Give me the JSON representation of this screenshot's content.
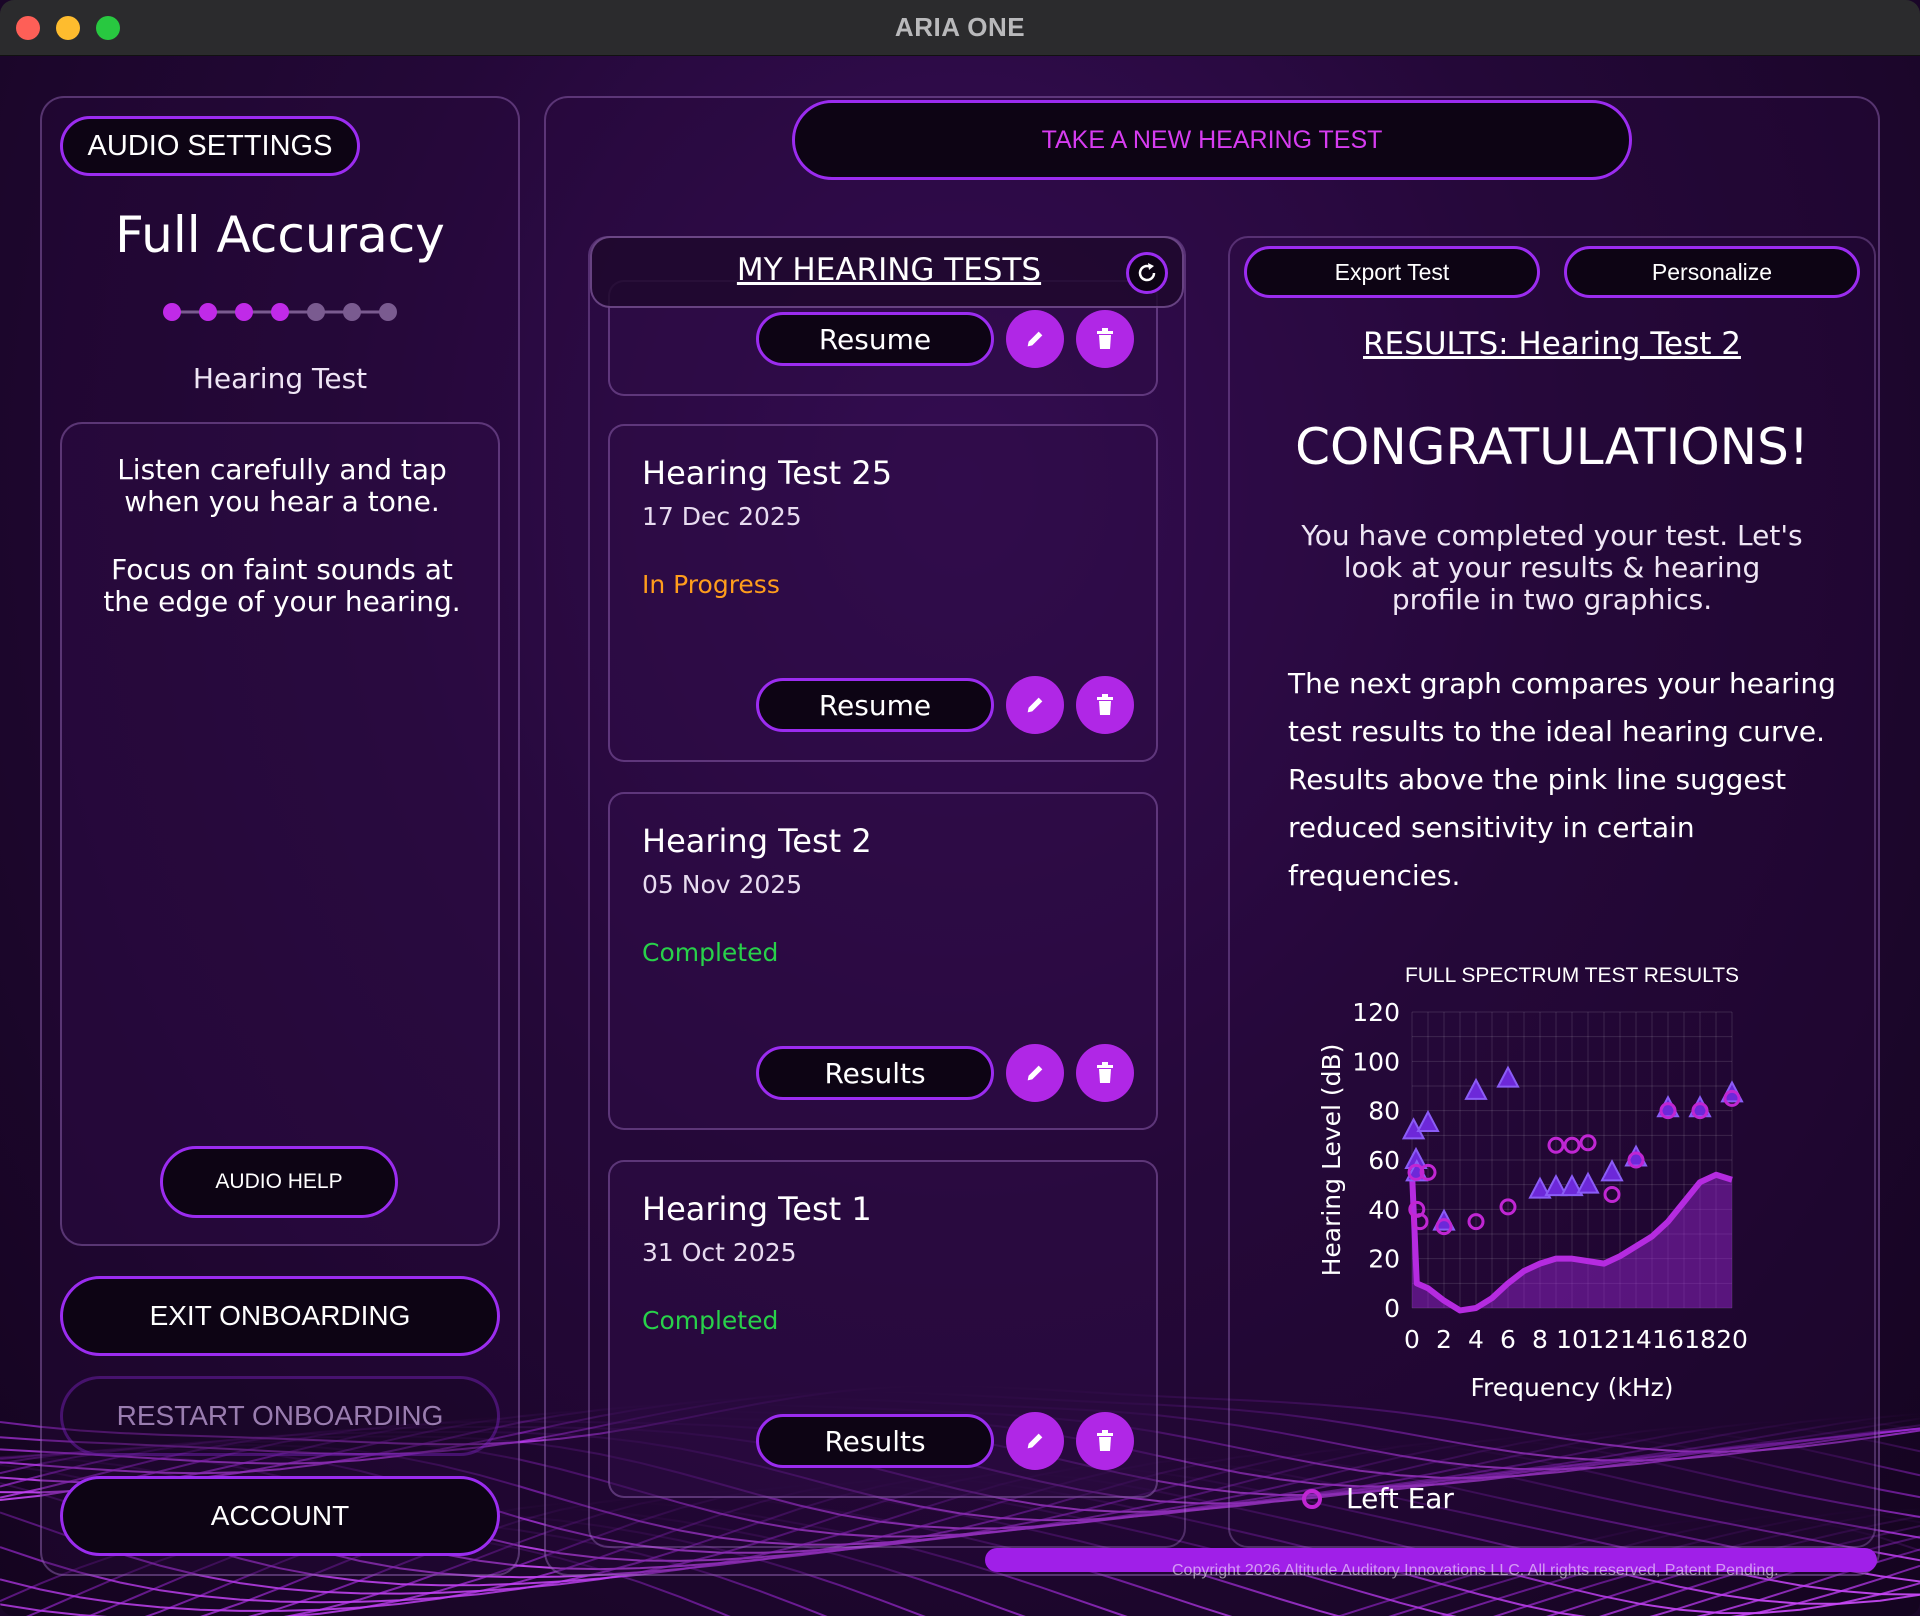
{
  "window": {
    "title": "ARIA ONE"
  },
  "left": {
    "audio_settings": "AUDIO SETTINGS",
    "mode": "Full Accuracy",
    "progress": {
      "total_steps": 7,
      "current_step": 4
    },
    "step_label": "Hearing Test",
    "instruction_1": "Listen carefully and tap when you hear a tone.",
    "instruction_2": "Focus on faint sounds at the edge of your hearing.",
    "audio_help": "AUDIO HELP",
    "exit_onboarding": "EXIT ONBOARDING",
    "restart_onboarding": "RESTART ONBOARDING",
    "account": "ACCOUNT"
  },
  "main": {
    "take_test": "TAKE A NEW HEARING TEST",
    "tests_header": "MY HEARING TESTS",
    "partial_card_button": "Resume",
    "tests": [
      {
        "title": "Hearing Test 25",
        "date": "17 Dec 2025",
        "status": "In Progress",
        "status_color": "#ff9d1c",
        "button": "Resume"
      },
      {
        "title": "Hearing Test 2",
        "date": "05 Nov 2025",
        "status": "Completed",
        "status_color": "#28d14a",
        "button": "Results"
      },
      {
        "title": "Hearing Test 1",
        "date": "31 Oct 2025",
        "status": "Completed",
        "status_color": "#28d14a",
        "button": "Results"
      }
    ]
  },
  "results": {
    "export": "Export Test",
    "personalize": "Personalize",
    "heading": "RESULTS: Hearing Test 2",
    "congrats": "CONGRATULATIONS!",
    "intro": "You have completed your test. Let's look at your results & hearing profile in two graphics.",
    "para_lines": [
      "The next graph compares your hearing",
      "test results to the ideal hearing curve.",
      "Results above the pink line suggest",
      "reduced sensitivity in certain",
      "frequencies."
    ],
    "legend_left": "Left Ear"
  },
  "chart_data": {
    "type": "scatter",
    "title": "FULL SPECTRUM TEST RESULTS",
    "xlabel": "Frequency (kHz)",
    "ylabel": "Hearing Level (dB)",
    "xlim": [
      0,
      20
    ],
    "ylim": [
      0,
      120
    ],
    "xticks": [
      0,
      2,
      4,
      6,
      8,
      10,
      12,
      14,
      16,
      18,
      20
    ],
    "yticks": [
      0,
      20,
      40,
      60,
      80,
      100,
      120
    ],
    "grid": true,
    "colors": {
      "left": "#c026d3",
      "right": "#6d28d9",
      "curve": "#b52be0"
    },
    "series": [
      {
        "name": "Left Ear",
        "marker": "circle",
        "points": [
          [
            0.25,
            55
          ],
          [
            0.3,
            40
          ],
          [
            0.5,
            35
          ],
          [
            1,
            55
          ],
          [
            2,
            33
          ],
          [
            4,
            35
          ],
          [
            6,
            41
          ],
          [
            9,
            66
          ],
          [
            10,
            66
          ],
          [
            11,
            67
          ],
          [
            12.5,
            46
          ],
          [
            14,
            60
          ],
          [
            16,
            80
          ],
          [
            18,
            80
          ],
          [
            20,
            85
          ]
        ]
      },
      {
        "marker": "triangle",
        "points": [
          [
            0.1,
            72
          ],
          [
            0.25,
            60
          ],
          [
            0.3,
            55
          ],
          [
            1,
            75
          ],
          [
            2,
            35
          ],
          [
            4,
            88
          ],
          [
            6,
            93
          ],
          [
            8,
            48
          ],
          [
            9,
            49
          ],
          [
            10,
            49
          ],
          [
            11,
            50
          ],
          [
            12.5,
            55
          ],
          [
            14,
            61
          ],
          [
            16,
            81
          ],
          [
            18,
            81
          ],
          [
            20,
            87
          ]
        ]
      },
      {
        "marker": "curve",
        "points": [
          [
            0,
            55
          ],
          [
            0.3,
            10
          ],
          [
            1,
            8
          ],
          [
            2,
            3
          ],
          [
            3,
            -1
          ],
          [
            4,
            0
          ],
          [
            5,
            4
          ],
          [
            6,
            10
          ],
          [
            7,
            15
          ],
          [
            8,
            18
          ],
          [
            9,
            20
          ],
          [
            10,
            20
          ],
          [
            11,
            19
          ],
          [
            12,
            18
          ],
          [
            13,
            21
          ],
          [
            14,
            25
          ],
          [
            15,
            29
          ],
          [
            16,
            35
          ],
          [
            17,
            43
          ],
          [
            18,
            51
          ],
          [
            19,
            54
          ],
          [
            20,
            52
          ]
        ]
      }
    ]
  },
  "footer": {
    "copyright": "Copyright 2026 Altitude Auditory Innovations LLC. All rights reserved, Patent Pending."
  }
}
